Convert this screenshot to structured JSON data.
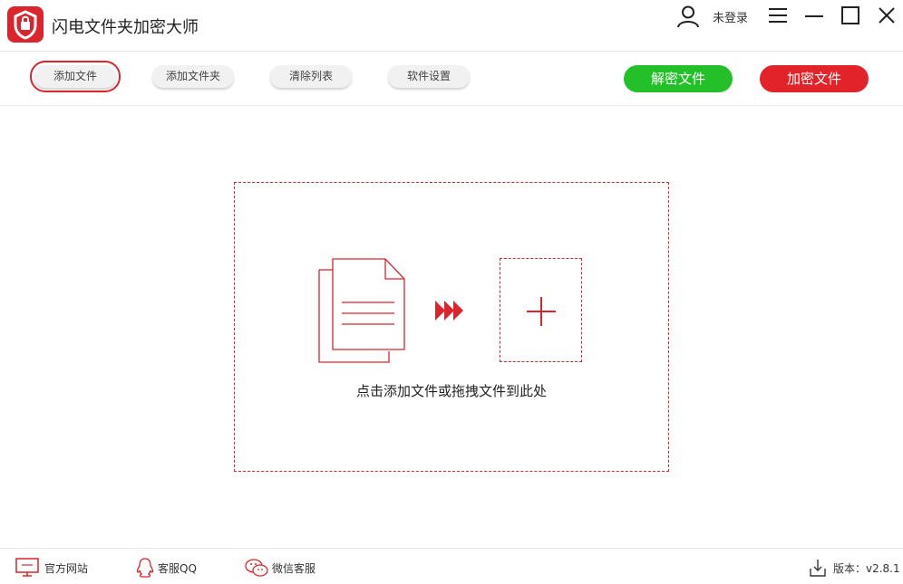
{
  "app": {
    "title": "闪电文件夹加密大师",
    "logo_icon": "shield-lock-icon",
    "brand_color": "#d9252b"
  },
  "header": {
    "login_label": "未登录"
  },
  "toolbar": {
    "add_file_label": "添加文件",
    "add_folder_label": "添加文件夹",
    "clear_list_label": "清除列表",
    "settings_label": "软件设置",
    "decrypt_label": "解密文件",
    "encrypt_label": "加密文件",
    "decrypt_color": "#23c02a",
    "encrypt_color": "#e2232a"
  },
  "dropzone": {
    "hint": "点击添加文件或拖拽文件到此处"
  },
  "footer": {
    "website_label": "官方网站",
    "qq_label": "客服QQ",
    "wechat_label": "微信客服",
    "version_label": "版本：v2.8.1"
  }
}
